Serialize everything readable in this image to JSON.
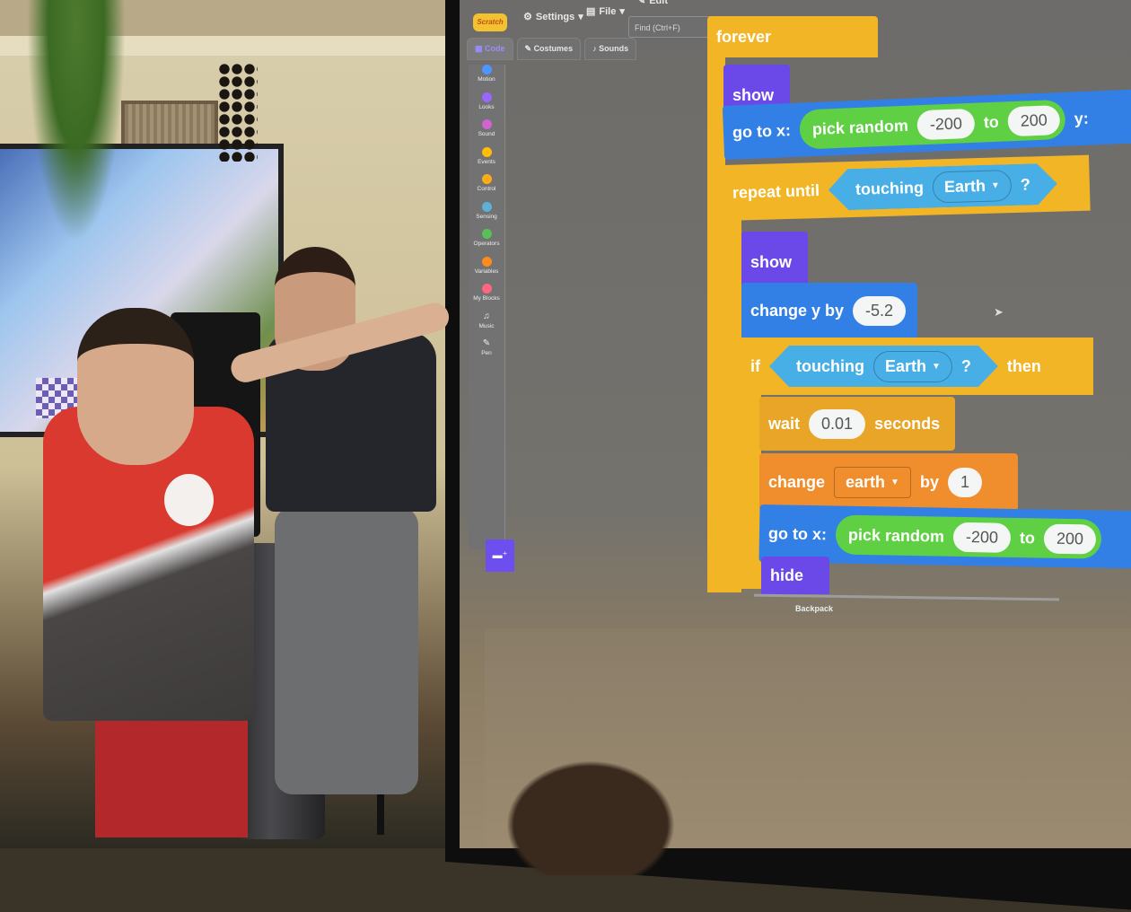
{
  "scene": {
    "description": "Classroom photo: child pointing at projected Scratch editor, instructor seated"
  },
  "scratch": {
    "menu": {
      "logo": "Scratch",
      "settings": "Settings",
      "file": "File",
      "edit": "Edit",
      "find_placeholder": "Find (Ctrl+F)"
    },
    "tabs": [
      {
        "label": "Code",
        "icon": "code-icon",
        "active": true
      },
      {
        "label": "Costumes",
        "icon": "brush-icon",
        "active": false
      },
      {
        "label": "Sounds",
        "icon": "speaker-icon",
        "active": false
      }
    ],
    "categories": [
      {
        "label": "Motion",
        "color": "#4c97ff"
      },
      {
        "label": "Looks",
        "color": "#9966ff"
      },
      {
        "label": "Sound",
        "color": "#cf63cf"
      },
      {
        "label": "Events",
        "color": "#ffbf00"
      },
      {
        "label": "Control",
        "color": "#ffab19"
      },
      {
        "label": "Sensing",
        "color": "#5cb1d6"
      },
      {
        "label": "Operators",
        "color": "#59c059"
      },
      {
        "label": "Variables",
        "color": "#ff8c1a"
      },
      {
        "label": "My Blocks",
        "color": "#ff6680"
      },
      {
        "label": "Music",
        "glyph": "♫"
      },
      {
        "label": "Pen",
        "glyph": "✎"
      }
    ],
    "backpack_label": "Backpack",
    "script": {
      "forever": "forever",
      "show1": "show",
      "goto1": {
        "label": "go to x:",
        "op": "pick random",
        "from": "-200",
        "to_word": "to",
        "to": "200",
        "y_label": "y:"
      },
      "repeat_until": {
        "label": "repeat until",
        "cond": "touching",
        "target": "Earth",
        "q": "?"
      },
      "show2": "show",
      "change_y": {
        "label": "change y by",
        "value": "-5.2"
      },
      "if_block": {
        "label": "if",
        "cond": "touching",
        "target": "Earth",
        "q": "?",
        "then": "then"
      },
      "wait": {
        "label": "wait",
        "value": "0.01",
        "unit": "seconds"
      },
      "change_var": {
        "label": "change",
        "var": "earth",
        "by": "by",
        "value": "1"
      },
      "goto2": {
        "label": "go to x:",
        "op": "pick random",
        "from": "-200",
        "to_word": "to",
        "to": "200"
      },
      "hide": "hide"
    }
  }
}
